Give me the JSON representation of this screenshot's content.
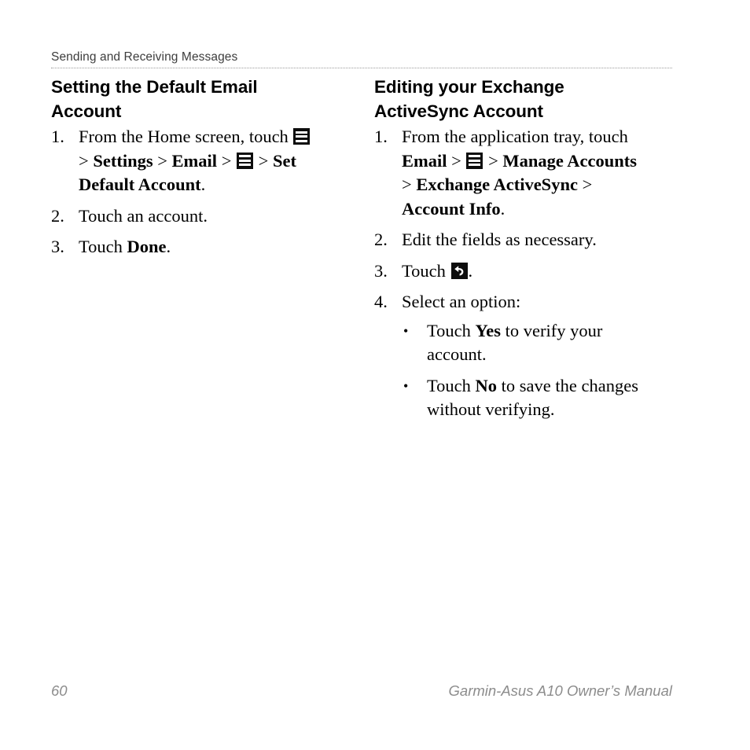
{
  "header": {
    "running_head": "Sending and Receiving Messages"
  },
  "left_column": {
    "title": "Setting the Default Email Account",
    "steps": [
      {
        "number": "1.",
        "parts": [
          {
            "type": "text",
            "text": "From the Home screen, touch "
          },
          {
            "type": "icon",
            "icon": "menu-icon"
          },
          {
            "type": "text",
            "text": " > "
          },
          {
            "type": "bold",
            "text": "Settings"
          },
          {
            "type": "text",
            "text": " > "
          },
          {
            "type": "bold",
            "text": "Email"
          },
          {
            "type": "text",
            "text": " > "
          },
          {
            "type": "icon",
            "icon": "menu-icon"
          },
          {
            "type": "text",
            "text": " > "
          },
          {
            "type": "bold",
            "text": "Set Default Account"
          },
          {
            "type": "text",
            "text": "."
          }
        ]
      },
      {
        "number": "2.",
        "parts": [
          {
            "type": "text",
            "text": "Touch an account."
          }
        ]
      },
      {
        "number": "3.",
        "parts": [
          {
            "type": "text",
            "text": "Touch "
          },
          {
            "type": "bold",
            "text": "Done"
          },
          {
            "type": "text",
            "text": "."
          }
        ]
      }
    ]
  },
  "right_column": {
    "title": "Editing your Exchange ActiveSync Account",
    "steps": [
      {
        "number": "1.",
        "parts": [
          {
            "type": "text",
            "text": "From the application tray, touch "
          },
          {
            "type": "bold",
            "text": "Email"
          },
          {
            "type": "text",
            "text": " > "
          },
          {
            "type": "icon",
            "icon": "menu-icon"
          },
          {
            "type": "text",
            "text": " > "
          },
          {
            "type": "bold",
            "text": "Manage Accounts"
          },
          {
            "type": "text",
            "text": " > "
          },
          {
            "type": "bold",
            "text": "Exchange ActiveSync"
          },
          {
            "type": "text",
            "text": " > "
          },
          {
            "type": "bold",
            "text": "Account Info"
          },
          {
            "type": "text",
            "text": "."
          }
        ]
      },
      {
        "number": "2.",
        "parts": [
          {
            "type": "text",
            "text": "Edit the fields as necessary."
          }
        ]
      },
      {
        "number": "3.",
        "parts": [
          {
            "type": "text",
            "text": "Touch "
          },
          {
            "type": "icon",
            "icon": "back-arrow-icon"
          },
          {
            "type": "text",
            "text": "."
          }
        ]
      },
      {
        "number": "4.",
        "parts": [
          {
            "type": "text",
            "text": "Select an option:"
          }
        ],
        "bullets": [
          {
            "marker": "•",
            "parts": [
              {
                "type": "text",
                "text": "Touch "
              },
              {
                "type": "bold",
                "text": "Yes"
              },
              {
                "type": "text",
                "text": " to verify your account."
              }
            ]
          },
          {
            "marker": "•",
            "parts": [
              {
                "type": "text",
                "text": "Touch "
              },
              {
                "type": "bold",
                "text": "No"
              },
              {
                "type": "text",
                "text": " to save the changes without verifying."
              }
            ]
          }
        ]
      }
    ]
  },
  "footer": {
    "page_number": "60",
    "manual_title": "Garmin-Asus A10 Owner’s Manual"
  },
  "colors": {
    "text": "#000000",
    "running_head": "#3d3d3d",
    "rule": "#9a9a9a",
    "footer": "#8c8c8c",
    "icon_background": "#0d0d0d",
    "icon_foreground": "#ffffff",
    "page_background": "#ffffff"
  }
}
